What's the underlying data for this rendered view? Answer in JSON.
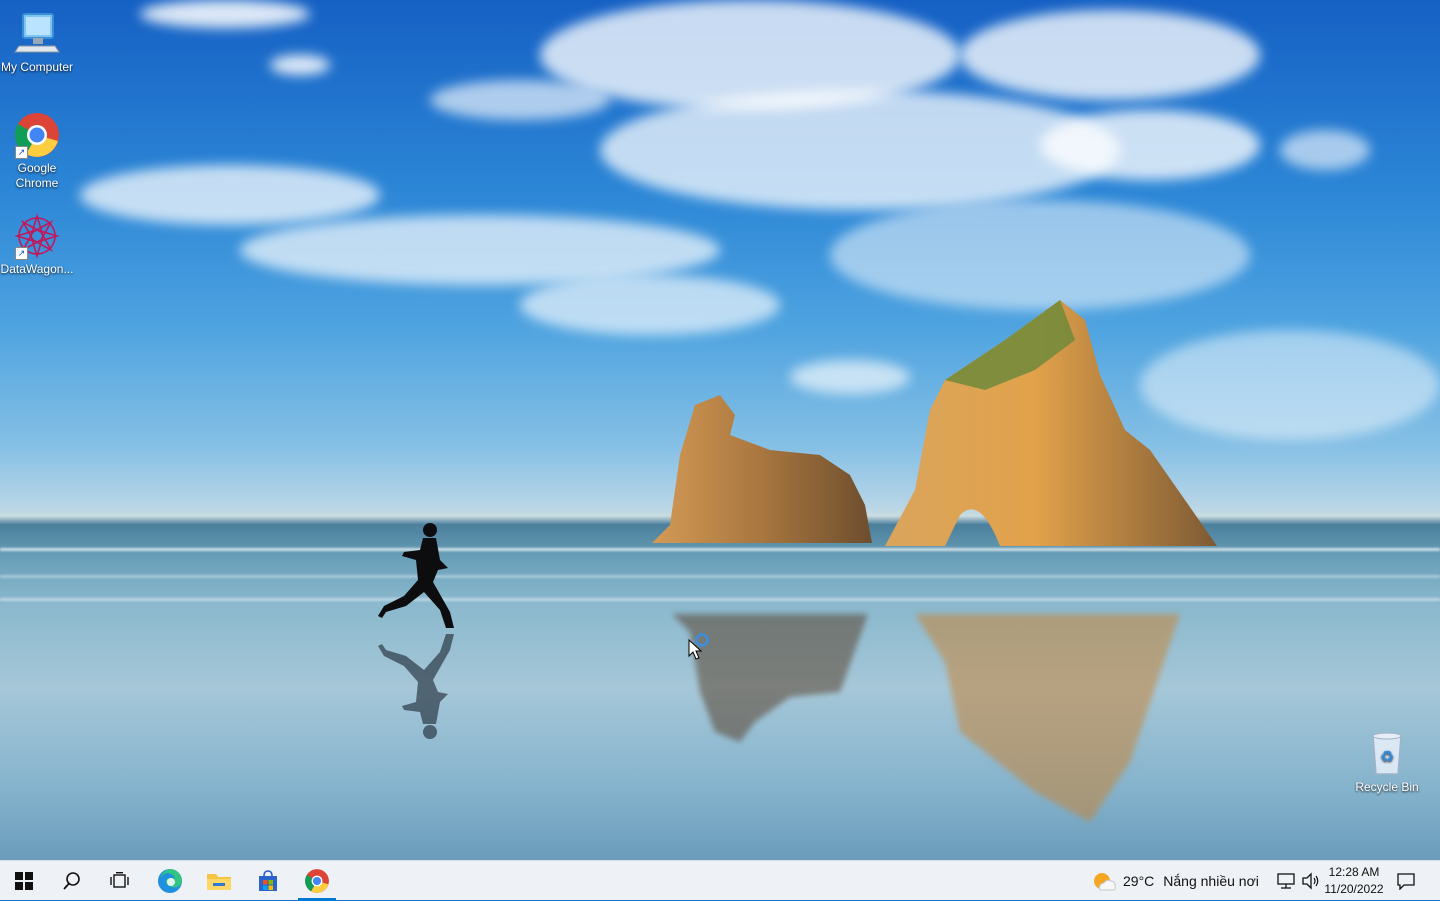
{
  "desktop_icons": [
    {
      "id": "my-computer",
      "label": "My Computer",
      "icon": "computer-icon"
    },
    {
      "id": "google-chrome",
      "label": "Google Chrome",
      "icon": "chrome-icon"
    },
    {
      "id": "datawagon",
      "label": "DataWagon...",
      "icon": "datawagon-icon"
    },
    {
      "id": "recycle-bin",
      "label": "Recycle Bin",
      "icon": "recycle-bin-icon"
    }
  ],
  "taskbar": {
    "pinned": [
      {
        "name": "start",
        "icon": "windows-logo-icon"
      },
      {
        "name": "search",
        "icon": "search-icon"
      },
      {
        "name": "task-view",
        "icon": "task-view-icon"
      },
      {
        "name": "edge",
        "icon": "edge-icon"
      },
      {
        "name": "file-explorer",
        "icon": "folder-icon"
      },
      {
        "name": "store",
        "icon": "store-icon"
      },
      {
        "name": "chrome",
        "icon": "chrome-icon"
      }
    ],
    "weather": {
      "temp": "29°C",
      "condition": "Nắng nhiều nơi",
      "icon": "sun-cloud-icon"
    },
    "tray_icons": [
      "network-icon",
      "volume-icon"
    ],
    "clock": {
      "time": "12:28 AM",
      "date": "11/20/2022"
    },
    "notification_icon": "notification-icon"
  },
  "colors": {
    "taskbar_bg": "#eef1f5",
    "accent": "#0078d4"
  }
}
